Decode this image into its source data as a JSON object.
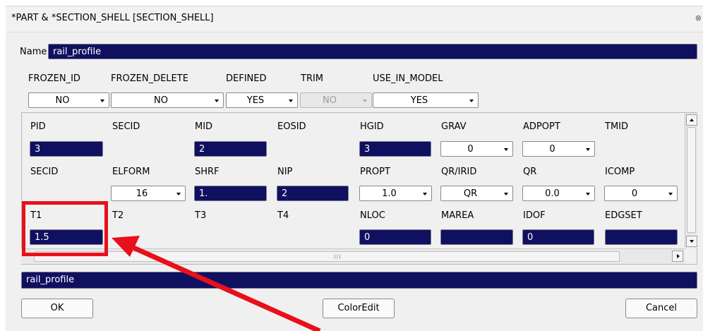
{
  "window": {
    "title": "*PART & *SECTION_SHELL [SECTION_SHELL]",
    "close_glyph": "⊗"
  },
  "name_row": {
    "label": "Name",
    "value": "rail_profile"
  },
  "flags": {
    "headers": [
      "FROZEN_ID",
      "FROZEN_DELETE",
      "DEFINED",
      "TRIM",
      "USE_IN_MODEL"
    ],
    "values": [
      "NO",
      "NO",
      "YES",
      "NO",
      "YES"
    ],
    "trim_disabled": true
  },
  "grid": {
    "row1": {
      "labels": [
        "PID",
        "SECID",
        "MID",
        "EOSID",
        "HGID",
        "GRAV",
        "ADPOPT",
        "TMID"
      ],
      "pid": "3",
      "mid": "2",
      "hgid": "3",
      "grav": "0",
      "adpopt": "0"
    },
    "row2": {
      "labels": [
        "SECID",
        "ELFORM",
        "SHRF",
        "NIP",
        "PROPT",
        "QR/IRID",
        "QR",
        "ICOMP"
      ],
      "elform": "16",
      "shrf": "1.",
      "nip": "2",
      "propt": "1.0",
      "qr_irid": "QR",
      "qr": "0.0",
      "icomp": "0"
    },
    "row3": {
      "labels": [
        "T1",
        "T2",
        "T3",
        "T4",
        "NLOC",
        "MAREA",
        "IDOF",
        "EDGSET"
      ],
      "t1": "1.5",
      "nloc": "0",
      "marea": "",
      "idof": "0",
      "edgset": ""
    }
  },
  "scroll": {
    "grip": "III"
  },
  "footer": {
    "heading_value": "rail_profile"
  },
  "buttons": {
    "ok": "OK",
    "coloredit": "ColorEdit",
    "cancel": "Cancel"
  },
  "annotation": {
    "color": "#e8101a",
    "target": "T1"
  },
  "colors": {
    "field_bg": "#101060",
    "panel_bg": "#f0f0f0",
    "accent_red": "#e8101a"
  }
}
